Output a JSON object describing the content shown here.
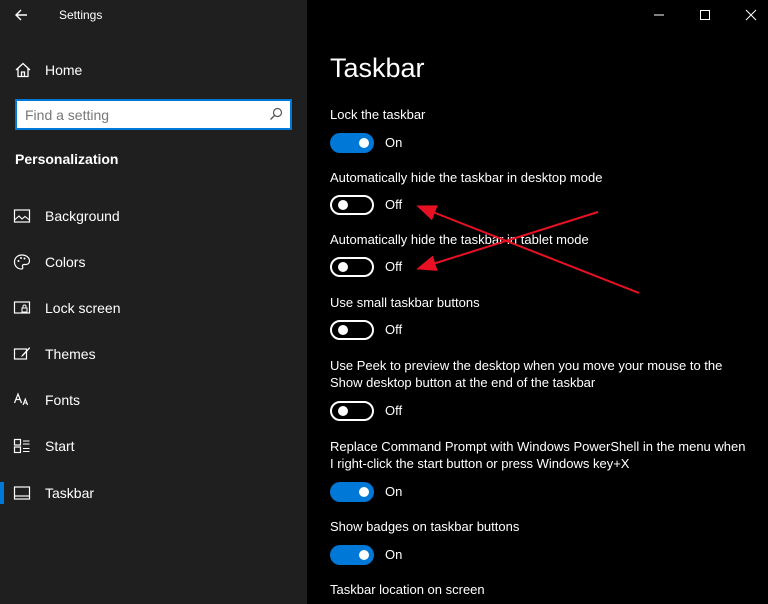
{
  "app": {
    "title": "Settings"
  },
  "sidebar": {
    "home_label": "Home",
    "search_placeholder": "Find a setting",
    "section": "Personalization",
    "items": [
      {
        "label": "Background",
        "icon": "image-icon"
      },
      {
        "label": "Colors",
        "icon": "palette-icon"
      },
      {
        "label": "Lock screen",
        "icon": "lock-screen-icon"
      },
      {
        "label": "Themes",
        "icon": "brush-icon"
      },
      {
        "label": "Fonts",
        "icon": "fonts-icon"
      },
      {
        "label": "Start",
        "icon": "start-icon"
      },
      {
        "label": "Taskbar",
        "icon": "taskbar-icon",
        "selected": true
      }
    ]
  },
  "main": {
    "title": "Taskbar",
    "settings": [
      {
        "label": "Lock the taskbar",
        "state": "On"
      },
      {
        "label": "Automatically hide the taskbar in desktop mode",
        "state": "Off"
      },
      {
        "label": "Automatically hide the taskbar in tablet mode",
        "state": "Off"
      },
      {
        "label": "Use small taskbar buttons",
        "state": "Off"
      },
      {
        "label": "Use Peek to preview the desktop when you move your mouse to the Show desktop button at the end of the taskbar",
        "state": "Off"
      },
      {
        "label": "Replace Command Prompt with Windows PowerShell in the menu when I right-click the start button or press Windows key+X",
        "state": "On"
      },
      {
        "label": "Show badges on taskbar buttons",
        "state": "On"
      },
      {
        "label": "Taskbar location on screen"
      }
    ]
  },
  "colors": {
    "accent": "#0078d7",
    "annotation": "#e81123",
    "sidebar_bg": "#1f1f1f",
    "main_bg": "#000000"
  }
}
